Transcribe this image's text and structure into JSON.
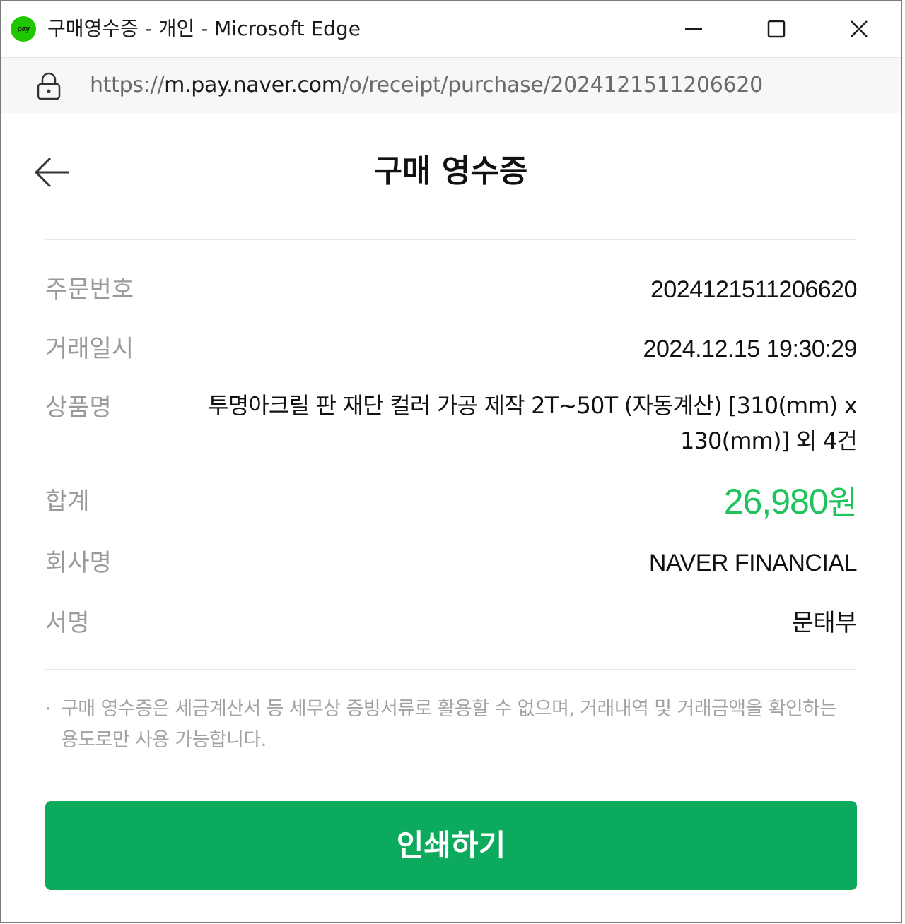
{
  "window": {
    "app_icon_text": "pay",
    "title": "구매영수증 - 개인 - Microsoft Edge"
  },
  "address_bar": {
    "scheme": "https://",
    "host": "m.pay.naver.com",
    "path": "/o/receipt/purchase/2024121511206620"
  },
  "page": {
    "title": "구매 영수증"
  },
  "receipt": {
    "order_number": {
      "label": "주문번호",
      "value": "2024121511206620"
    },
    "transaction_date": {
      "label": "거래일시",
      "value": "2024.12.15 19:30:29"
    },
    "product_name": {
      "label": "상품명",
      "value": "투명아크릴 판 재단 컬러 가공 제작 2T~50T (자동계산) [310(mm) x 130(mm)] 외 4건"
    },
    "total": {
      "label": "합계",
      "amount": "26,980",
      "unit": "원"
    },
    "company": {
      "label": "회사명",
      "value": "NAVER FINANCIAL"
    },
    "signature": {
      "label": "서명",
      "value": "문태부"
    }
  },
  "notice": {
    "bullet": "·",
    "text": "구매 영수증은 세금계산서 등 세무상 증빙서류로 활용할 수 없으며, 거래내역 및 거래금액을 확인하는 용도로만 사용 가능합니다."
  },
  "print_button": {
    "label": "인쇄하기"
  },
  "colors": {
    "total_amount": "#1ec45b",
    "print_button_bg": "#0baa5c",
    "app_icon_bg": "#1ec800"
  }
}
